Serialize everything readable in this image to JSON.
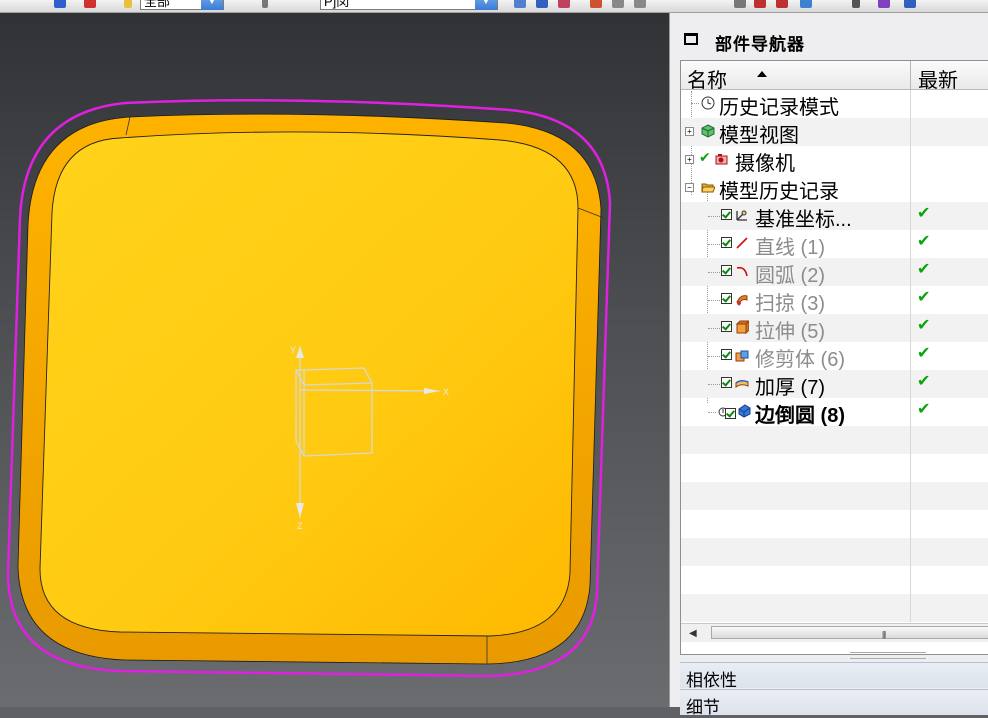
{
  "toolbar": {
    "filter_value": "全部",
    "view_value": "P]闵"
  },
  "navigator": {
    "title": "部件导航器",
    "columns": {
      "name": "名称",
      "latest": "最新"
    },
    "tree": {
      "history_mode": "历史记录模式",
      "model_views": "模型视图",
      "cameras": "摄像机",
      "model_history": "模型历史记录",
      "features": [
        {
          "label": "基准坐标...",
          "latest": "✔",
          "icon": "datum-csys-icon"
        },
        {
          "label": "直线 (1)",
          "latest": "✔",
          "icon": "line-icon"
        },
        {
          "label": "圆弧 (2)",
          "latest": "✔",
          "icon": "arc-icon"
        },
        {
          "label": "扫掠 (3)",
          "latest": "✔",
          "icon": "swept-icon"
        },
        {
          "label": "拉伸 (5)",
          "latest": "✔",
          "icon": "extrude-icon"
        },
        {
          "label": "修剪体 (6)",
          "latest": "✔",
          "icon": "trim-body-icon"
        },
        {
          "label": "加厚 (7)",
          "latest": "✔",
          "icon": "thicken-icon"
        },
        {
          "label": "边倒圆 (8)",
          "latest": "✔",
          "icon": "edge-blend-icon"
        }
      ]
    },
    "panels": {
      "dependencies": "相依性",
      "details": "细节"
    }
  },
  "viewport": {
    "axis_x": "X",
    "axis_y": "Y",
    "axis_z": "Z",
    "part_color": "#FFC200",
    "highlight_color": "#E020E0"
  }
}
